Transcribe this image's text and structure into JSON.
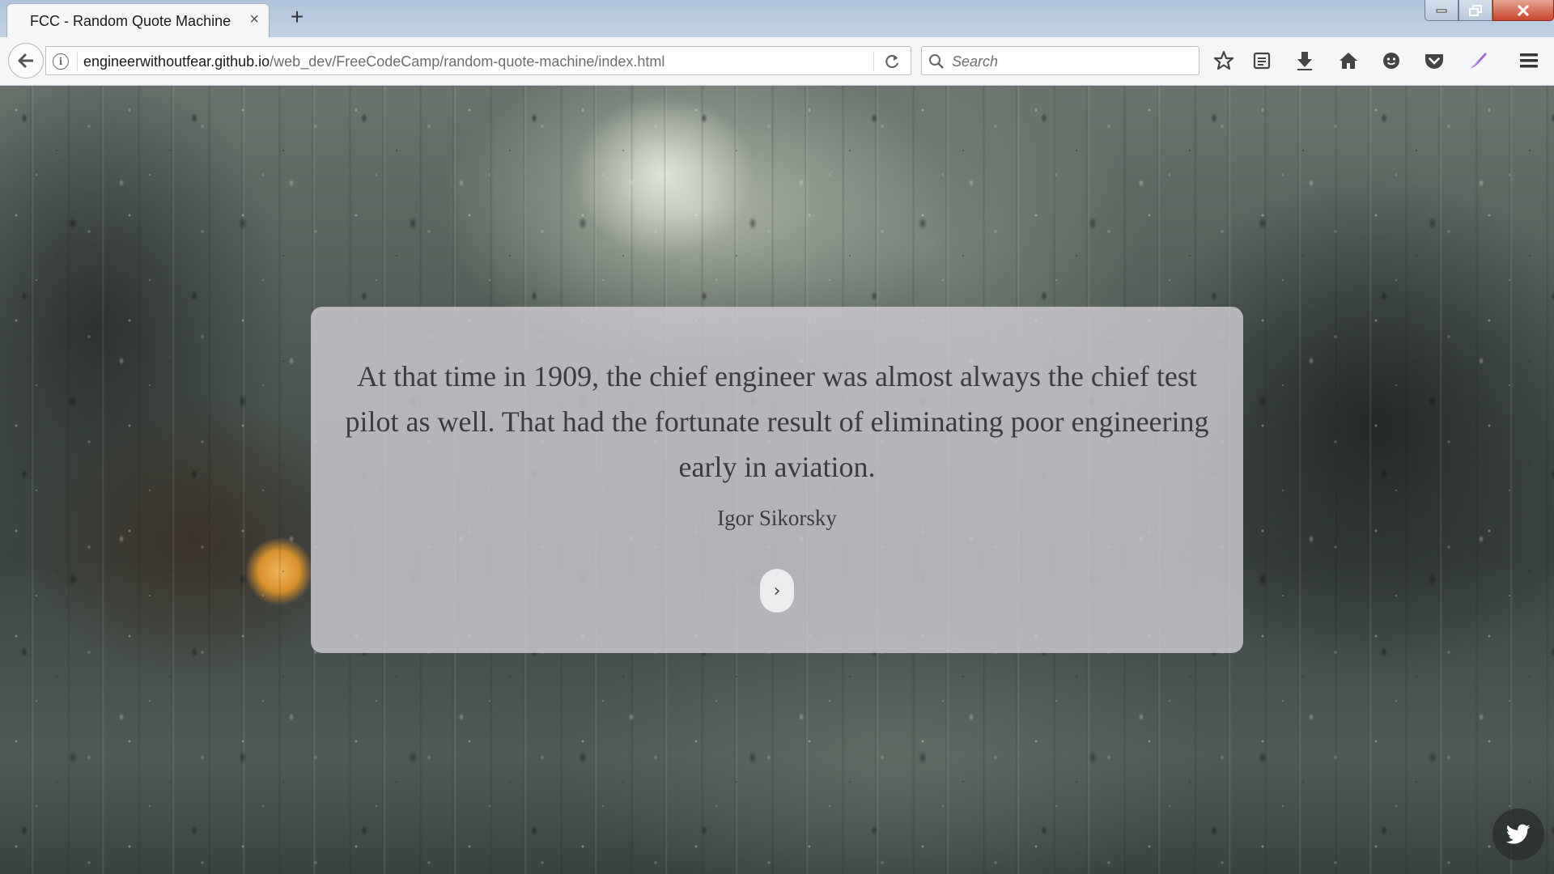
{
  "browser": {
    "tab": {
      "title": "FCC - Random Quote Machine",
      "close_glyph": "×"
    },
    "new_tab_glyph": "+",
    "url": {
      "domain": "engineerwithoutfear.github.io",
      "path": "/web_dev/FreeCodeCamp/random-quote-machine/index.html"
    },
    "search": {
      "placeholder": "Search"
    },
    "info_glyph": "i",
    "toolbar_icons": [
      "bookmark-star-icon",
      "reading-list-icon",
      "download-icon",
      "home-icon",
      "smiley-icon",
      "pocket-icon",
      "theme-icon",
      "menu-icon"
    ],
    "window_controls": [
      "minimize-icon",
      "restore-icon",
      "close-icon"
    ]
  },
  "quote": {
    "text": "At that time in 1909, the chief engineer was almost always the chief test pilot as well. That had the fortunate result of eliminating poor engineering early in aviation.",
    "author": "Igor Sikorsky",
    "next_glyph": "›"
  },
  "share": {
    "icon": "twitter-icon"
  },
  "colors": {
    "card_bg": "#d2cdd7",
    "text": "#3c3c3c",
    "chrome_bg": "#f5f6f7",
    "tabstrip_bg": "#b8cbe0",
    "close_button": "#c7452c"
  }
}
